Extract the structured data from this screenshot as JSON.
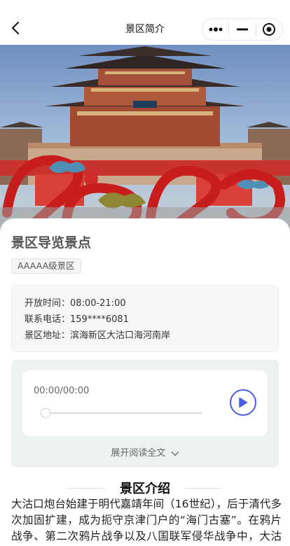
{
  "nav": {
    "title": "景区简介",
    "icons": {
      "back": "back-arrow-icon",
      "more": "more-dots-icon",
      "minimize": "minimize-icon",
      "close": "target-close-icon"
    }
  },
  "hero": {
    "image": "scenic-tower-photo"
  },
  "spot": {
    "title": "景区导览景点",
    "tag": "AAAAA级景区"
  },
  "info": {
    "hours": "开放时间：08:00-21:00",
    "phone": "联系电话：159****6081",
    "address": "景区地址：滨海新区大沽口海河南岸"
  },
  "audio": {
    "time": "00:00/00:00",
    "progress": 0,
    "expand_label": "展开阅读全文",
    "colors": {
      "accent": "#4a5de6"
    }
  },
  "intro": {
    "title": "景区介绍",
    "text": "大沽口炮台始建于明代嘉靖年间（16世纪），后于清代多次加固扩建，成为扼守京津门户的“海门古塞”。在鸦片战争、第二次鸦片战争以及八国联军侵华战争中，大沽口炮台曾多次爆发激烈战斗，中国军民在此"
  }
}
